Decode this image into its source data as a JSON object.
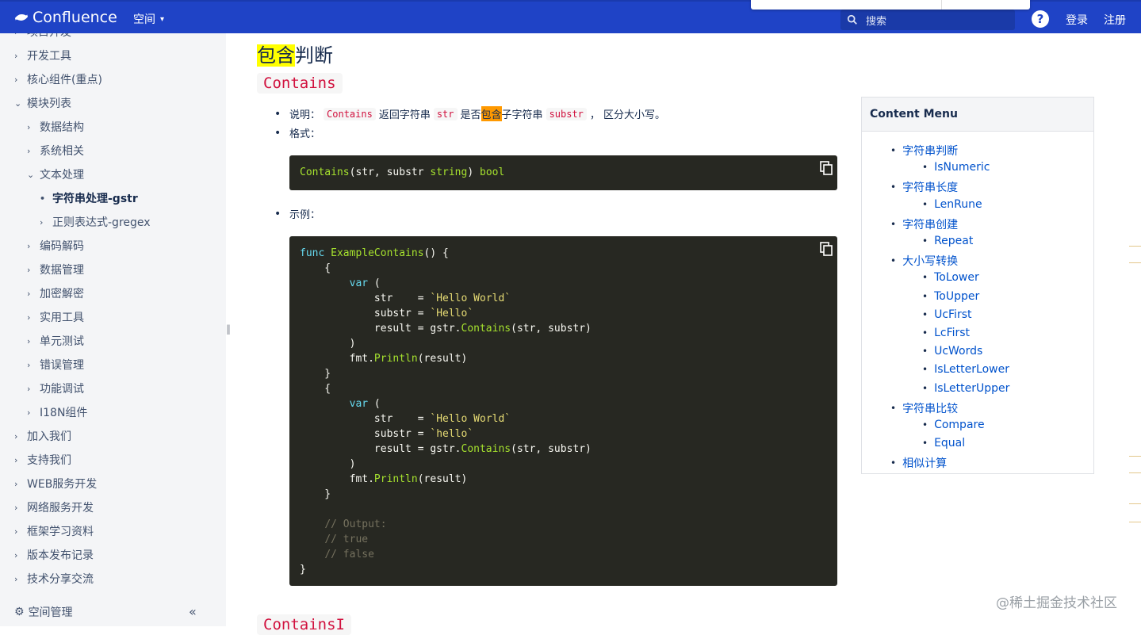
{
  "topbar": {
    "app_name": "Confluence",
    "space_menu": "空间",
    "search_placeholder": "搜索",
    "help_icon": "?",
    "login": "登录",
    "register": "注册"
  },
  "sidebar": {
    "items": [
      {
        "label": "项目开发",
        "level": 0,
        "arrow": "›"
      },
      {
        "label": "开发工具",
        "level": 0,
        "arrow": "›"
      },
      {
        "label": "核心组件(重点)",
        "level": 0,
        "arrow": "›"
      },
      {
        "label": "模块列表",
        "level": 0,
        "arrow": "⌄"
      },
      {
        "label": "数据结构",
        "level": 1,
        "arrow": "›"
      },
      {
        "label": "系统相关",
        "level": 1,
        "arrow": "›"
      },
      {
        "label": "文本处理",
        "level": 1,
        "arrow": "⌄"
      },
      {
        "label": "字符串处理-gstr",
        "level": 2,
        "arrow": "•"
      },
      {
        "label": "正则表达式-gregex",
        "level": 2,
        "arrow": "›"
      },
      {
        "label": "编码解码",
        "level": 1,
        "arrow": "›"
      },
      {
        "label": "数据管理",
        "level": 1,
        "arrow": "›"
      },
      {
        "label": "加密解密",
        "level": 1,
        "arrow": "›"
      },
      {
        "label": "实用工具",
        "level": 1,
        "arrow": "›"
      },
      {
        "label": "单元测试",
        "level": 1,
        "arrow": "›"
      },
      {
        "label": "错误管理",
        "level": 1,
        "arrow": "›"
      },
      {
        "label": "功能调试",
        "level": 1,
        "arrow": "›"
      },
      {
        "label": "I18N组件",
        "level": 1,
        "arrow": "›"
      },
      {
        "label": "加入我们",
        "level": 0,
        "arrow": "›"
      },
      {
        "label": "支持我们",
        "level": 0,
        "arrow": "›"
      },
      {
        "label": "WEB服务开发",
        "level": 0,
        "arrow": "›"
      },
      {
        "label": "网络服务开发",
        "level": 0,
        "arrow": "›"
      },
      {
        "label": "框架学习资料",
        "level": 0,
        "arrow": "›"
      },
      {
        "label": "版本发布记录",
        "level": 0,
        "arrow": "›"
      },
      {
        "label": "技术分享交流",
        "level": 0,
        "arrow": "›"
      }
    ],
    "footer_label": "空间管理",
    "collapse_icon": "«"
  },
  "main": {
    "title_highlight": "包含",
    "title_rest": "判断",
    "section_heading": "Contains",
    "desc_label": "说明：",
    "desc_func": "Contains",
    "desc_t1": "返回字符串",
    "desc_str": "str",
    "desc_t2": "是否",
    "desc_hl": "包含",
    "desc_t3": "子字符串",
    "desc_substr": "substr",
    "desc_t4": "， 区分大小写。",
    "format_label": "格式：",
    "example_label": "示例：",
    "next_heading": "ContainsI"
  },
  "content_menu": {
    "title": "Content Menu",
    "items": [
      {
        "label": "字符串判断",
        "level": 0
      },
      {
        "label": "IsNumeric",
        "level": 1
      },
      {
        "label": "字符串长度",
        "level": 0
      },
      {
        "label": "LenRune",
        "level": 1
      },
      {
        "label": "字符串创建",
        "level": 0
      },
      {
        "label": "Repeat",
        "level": 1
      },
      {
        "label": "大小写转换",
        "level": 0
      },
      {
        "label": "ToLower",
        "level": 1
      },
      {
        "label": "ToUpper",
        "level": 1
      },
      {
        "label": "UcFirst",
        "level": 1
      },
      {
        "label": "LcFirst",
        "level": 1
      },
      {
        "label": "UcWords",
        "level": 1
      },
      {
        "label": "IsLetterLower",
        "level": 1
      },
      {
        "label": "IsLetterUpper",
        "level": 1
      },
      {
        "label": "字符串比较",
        "level": 0
      },
      {
        "label": "Compare",
        "level": 1
      },
      {
        "label": "Equal",
        "level": 1
      },
      {
        "label": "相似计算",
        "level": 0
      }
    ]
  },
  "watermark": "@稀土掘金技术社区"
}
